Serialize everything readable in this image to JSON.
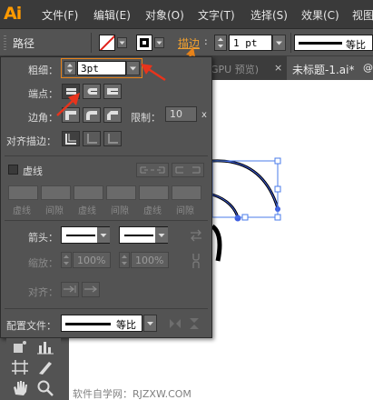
{
  "app": {
    "logo": "Ai"
  },
  "menu": [
    "文件(F)",
    "编辑(E)",
    "对象(O)",
    "文字(T)",
    "选择(S)",
    "效果(C)",
    "视图"
  ],
  "controlbar": {
    "object_type": "路径",
    "stroke_link": "描边",
    "stroke_weight": "1 pt",
    "profile": "等比"
  },
  "tabs": [
    "GPU 预览)",
    "未标题-1.ai*"
  ],
  "tab_close": "×",
  "tab_more": "@",
  "stroke_panel": {
    "weight_label": "粗细：",
    "weight_value": "3pt",
    "cap_label": "端点：",
    "corner_label": "边角：",
    "limit_label": "限制：",
    "limit_value": "10",
    "limit_x": "x",
    "align_label": "对齐描边：",
    "dashed_label": "虚线",
    "dash_labels": [
      "虚线",
      "间隙",
      "虚线",
      "间隙",
      "虚线",
      "间隙"
    ],
    "arrow_label": "箭头：",
    "scale_label": "缩放：",
    "scale_start": "100%",
    "scale_end": "100%",
    "align_arrow_label": "对齐：",
    "profile_label": "配置文件：",
    "profile_value": "等比"
  },
  "footer": {
    "watermark": "软件自学网：RJZXW.COM"
  },
  "colors": {
    "highlight": "#e8831a",
    "annotation": "#e8341c",
    "selection": "#3e5ee0"
  }
}
